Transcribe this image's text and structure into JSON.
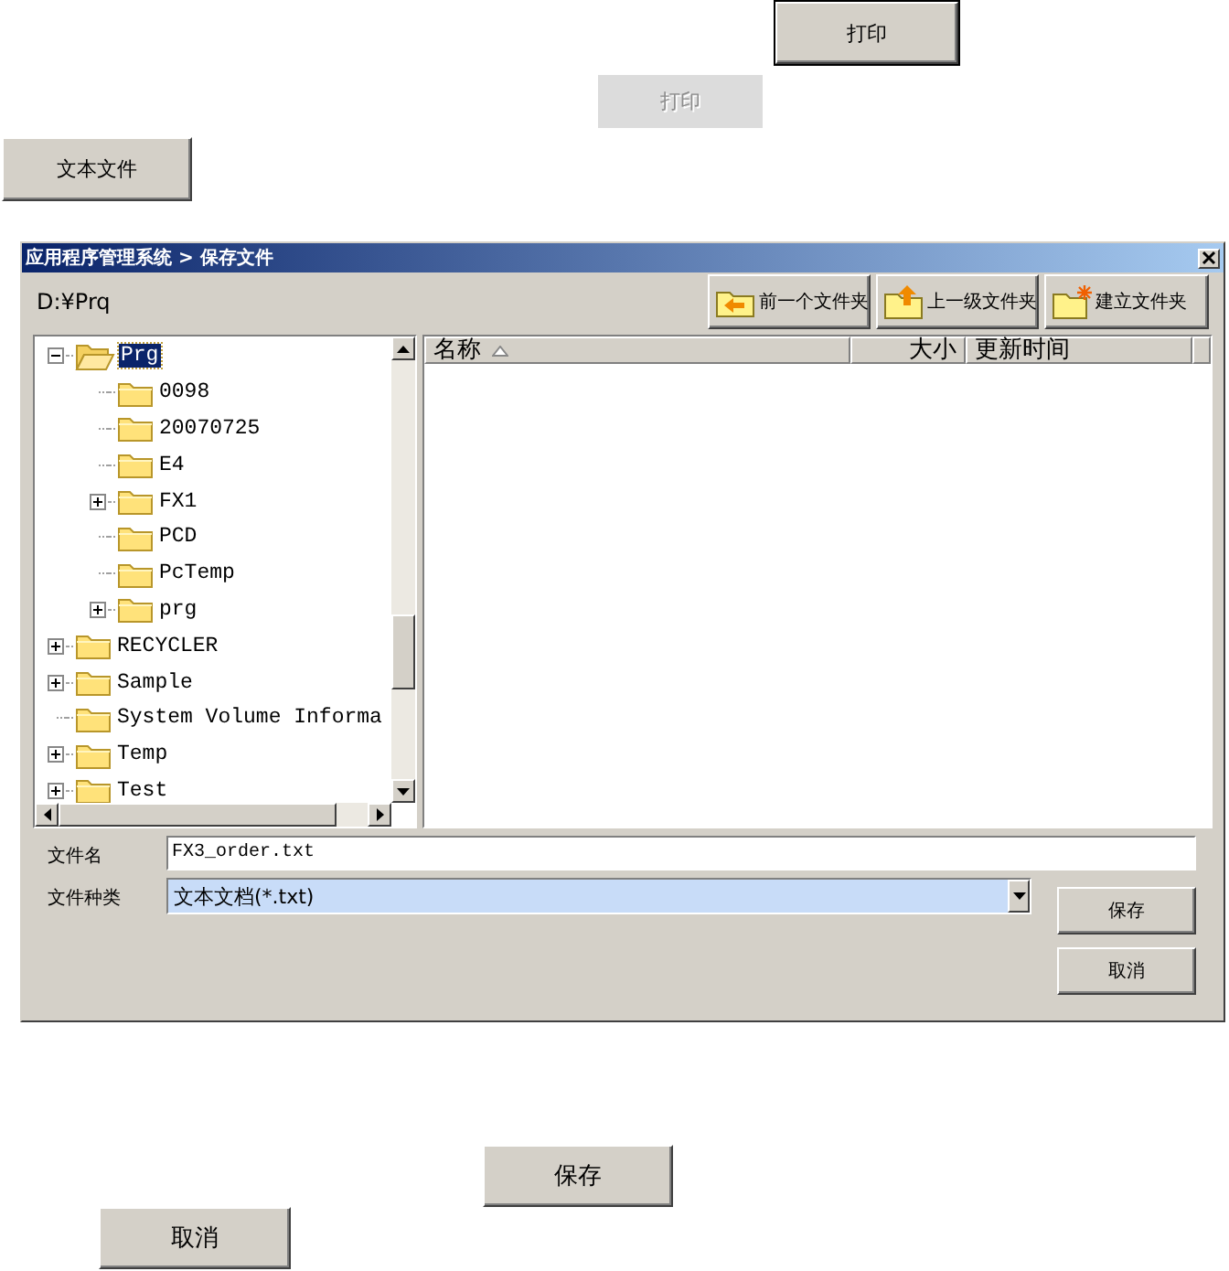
{
  "top_buttons": [
    {
      "label": "打印",
      "disabled": false,
      "default": true
    },
    {
      "label": "打印",
      "disabled": true,
      "default": false
    },
    {
      "label": "文本文件",
      "disabled": false,
      "default": false
    }
  ],
  "dialog": {
    "title": "应用程序管理系统 > 保存文件",
    "path": "D:¥Prq",
    "toolbar": [
      {
        "kind": "back",
        "label": "前一个文件夹"
      },
      {
        "kind": "up",
        "label": "上一级文件夹"
      },
      {
        "kind": "new",
        "label": "建立文件夹"
      }
    ],
    "tree": [
      {
        "label": "Prg",
        "kind": "branch",
        "expanded": true,
        "selected": true,
        "children": [
          {
            "label": "0098",
            "kind": "leaf",
            "selected": false
          },
          {
            "label": "20070725",
            "kind": "leaf",
            "selected": false
          },
          {
            "label": "E4",
            "kind": "leaf",
            "selected": false
          },
          {
            "label": "FX1",
            "kind": "branch",
            "expanded": false,
            "selected": false
          },
          {
            "label": "PCD",
            "kind": "leaf",
            "selected": false
          },
          {
            "label": "PcTemp",
            "kind": "leaf",
            "selected": false
          },
          {
            "label": "prg",
            "kind": "branch",
            "expanded": false,
            "selected": false
          }
        ]
      },
      {
        "label": "RECYCLER",
        "kind": "branch",
        "expanded": false,
        "selected": false
      },
      {
        "label": "Sample",
        "kind": "branch",
        "expanded": false,
        "selected": false
      },
      {
        "label": "System Volume Informa",
        "kind": "leaf",
        "selected": false
      },
      {
        "label": "Temp",
        "kind": "branch",
        "expanded": false,
        "selected": false
      },
      {
        "label": "Test",
        "kind": "branch",
        "expanded": false,
        "selected": false
      }
    ],
    "columns": [
      {
        "label": "名称",
        "sorted": true
      },
      {
        "label": "大小",
        "sorted": false
      },
      {
        "label": "更新时间",
        "sorted": false
      }
    ],
    "file_name": {
      "label": "文件名",
      "value": "FX3_order.txt"
    },
    "file_type": {
      "label": "文件种类",
      "value": "文本文档(*.txt)"
    },
    "buttons": [
      "保存",
      "取消"
    ]
  },
  "bottom_buttons": [
    {
      "label": "保存",
      "disabled": false,
      "default": false
    },
    {
      "label": "取消",
      "disabled": false,
      "default": false
    }
  ]
}
